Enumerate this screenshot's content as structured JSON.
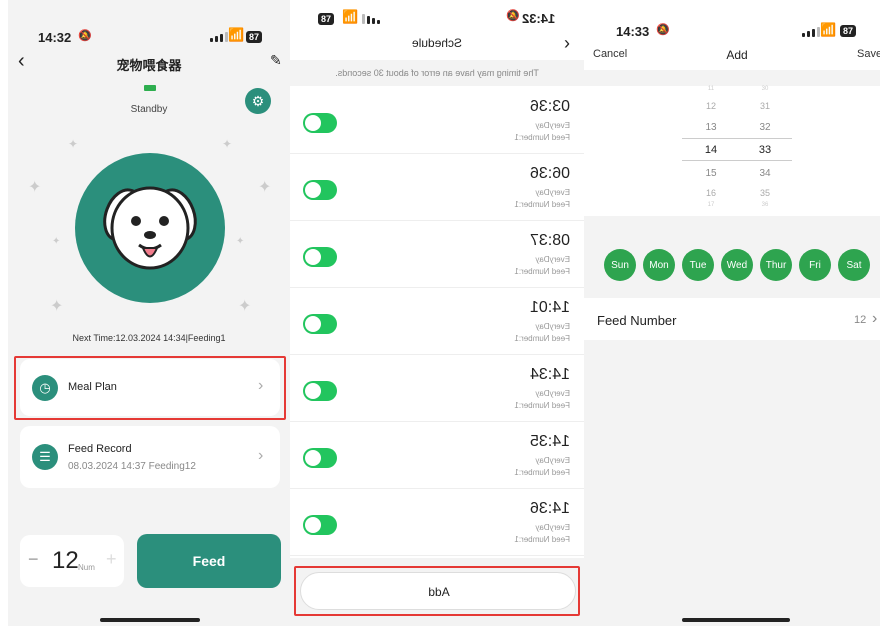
{
  "colors": {
    "teal": "#2b8f7c",
    "green_toggle": "#22c55e",
    "day_green": "#2ea44f",
    "highlight_red": "#e53935"
  },
  "panel1": {
    "time": "14:32",
    "battery": "87",
    "title": "宠物喂食器",
    "status": "Standby",
    "next_time": "Next Time:12.03.2024 14:34|Feeding1",
    "meal_plan": "Meal Plan",
    "feed_record_title": "Feed Record",
    "feed_record_sub": "08.03.2024 14:37 Feeding12",
    "qty_minus": "−",
    "qty_value": "12",
    "qty_unit": "Num",
    "qty_plus": "+",
    "feed_button": "Feed"
  },
  "panel2": {
    "time": "14:32",
    "battery": "87",
    "title": "Schedule",
    "notice": "The timing may have an error of about 30 seconds.",
    "items": [
      {
        "time": "03:36",
        "repeat": "EveryDay",
        "feed": "Feed Number:1"
      },
      {
        "time": "06:36",
        "repeat": "EveryDay",
        "feed": "Feed Number:1"
      },
      {
        "time": "08:37",
        "repeat": "EveryDay",
        "feed": "Feed Number:1"
      },
      {
        "time": "14:01",
        "repeat": "EveryDay",
        "feed": "Feed Number:1"
      },
      {
        "time": "14:34",
        "repeat": "EveryDay",
        "feed": "Feed Number:1"
      },
      {
        "time": "14:35",
        "repeat": "EveryDay",
        "feed": "Feed Number:1"
      },
      {
        "time": "14:36",
        "repeat": "EveryDay",
        "feed": "Feed Number:1"
      }
    ],
    "add_button": "Add"
  },
  "panel3": {
    "time": "14:33",
    "battery": "87",
    "cancel": "Cancel",
    "title": "Add",
    "save": "Save",
    "hours": [
      "11",
      "12",
      "13",
      "14",
      "15",
      "16",
      "17"
    ],
    "minutes": [
      "30",
      "31",
      "32",
      "33",
      "34",
      "35",
      "36"
    ],
    "days": [
      "Sun",
      "Mon",
      "Tue",
      "Wed",
      "Thur",
      "Fri",
      "Sat"
    ],
    "feed_number_label": "Feed Number",
    "feed_number_value": "12"
  }
}
